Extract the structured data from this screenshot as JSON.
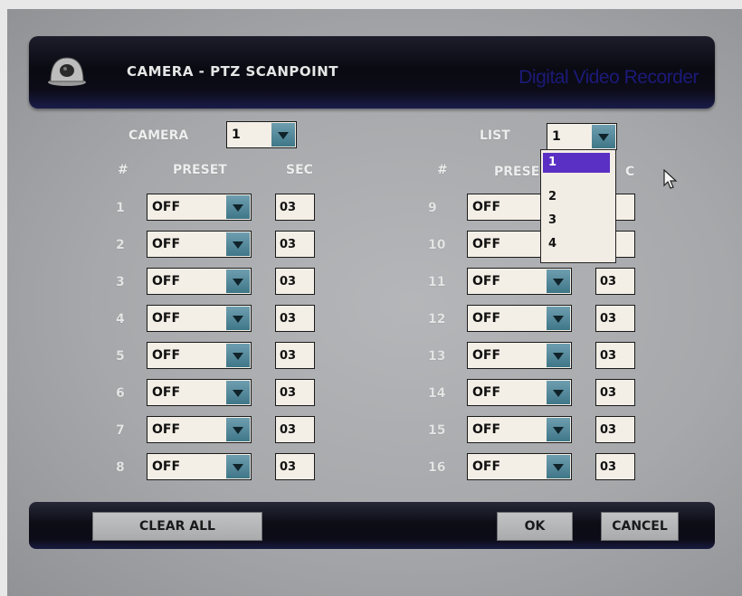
{
  "header": {
    "title": "CAMERA - PTZ SCANPOINT",
    "brand": "Digital Video Recorder",
    "icon": "dome-camera-icon"
  },
  "camera": {
    "label": "CAMERA",
    "value": "1"
  },
  "list": {
    "label": "LIST",
    "value": "1",
    "options": [
      "1",
      "2",
      "3",
      "4"
    ],
    "selected": "1",
    "open": true
  },
  "columns": {
    "num": "#",
    "preset": "PRESET",
    "sec": "SEC",
    "preset_right_visible": "PRESE",
    "sec_right_visible": "C"
  },
  "rows_left": [
    {
      "num": "1",
      "preset": "OFF",
      "sec": "03"
    },
    {
      "num": "2",
      "preset": "OFF",
      "sec": "03"
    },
    {
      "num": "3",
      "preset": "OFF",
      "sec": "03"
    },
    {
      "num": "4",
      "preset": "OFF",
      "sec": "03"
    },
    {
      "num": "5",
      "preset": "OFF",
      "sec": "03"
    },
    {
      "num": "6",
      "preset": "OFF",
      "sec": "03"
    },
    {
      "num": "7",
      "preset": "OFF",
      "sec": "03"
    },
    {
      "num": "8",
      "preset": "OFF",
      "sec": "03"
    }
  ],
  "rows_right": [
    {
      "num": "9",
      "preset": "OFF",
      "sec": ""
    },
    {
      "num": "10",
      "preset": "OFF",
      "sec": ""
    },
    {
      "num": "11",
      "preset": "OFF",
      "sec": "03"
    },
    {
      "num": "12",
      "preset": "OFF",
      "sec": "03"
    },
    {
      "num": "13",
      "preset": "OFF",
      "sec": "03"
    },
    {
      "num": "14",
      "preset": "OFF",
      "sec": "03"
    },
    {
      "num": "15",
      "preset": "OFF",
      "sec": "03"
    },
    {
      "num": "16",
      "preset": "OFF",
      "sec": "03"
    }
  ],
  "buttons": {
    "clear_all": "CLEAR ALL",
    "ok": "OK",
    "cancel": "CANCEL"
  },
  "colors": {
    "accent": "#5a2fc4",
    "arrow": "#4f8798",
    "brand": "#1c1a78"
  }
}
